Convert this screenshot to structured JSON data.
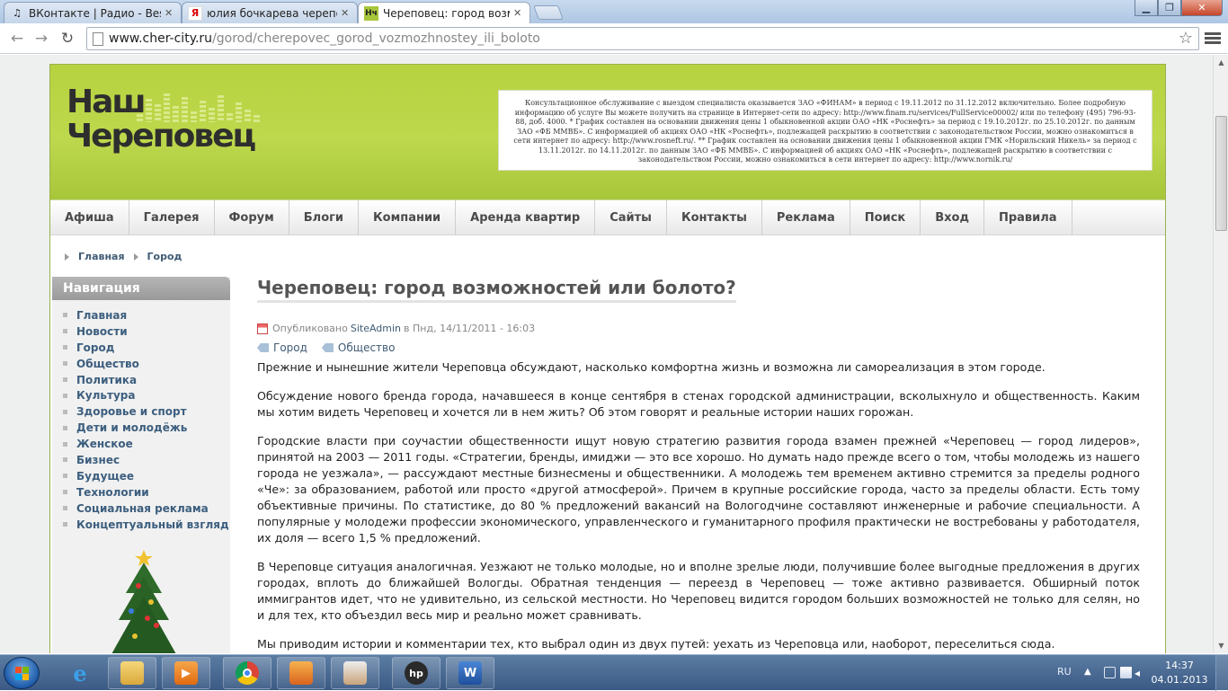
{
  "browser": {
    "tabs": [
      {
        "title": "ВКонтакте | Радио - Best F",
        "favicon": "music-note-icon",
        "active": false
      },
      {
        "title": "юлия бочкарева черепов",
        "favicon": "yandex-icon",
        "active": false
      },
      {
        "title": "Череповец: город возмож",
        "favicon": "nch-site-icon",
        "active": true
      }
    ],
    "url_domain": "www.cher-city.ru",
    "url_path": "/gorod/cherepovec_gorod_vozmozhnostey_ili_boloto"
  },
  "site": {
    "logo_line1": "Наш",
    "logo_line2": "Череповец",
    "ad_text": "Консультационное обслуживание с выездом специалиста оказывается ЗАО «ФИНАМ» в период с 19.11.2012 по 31.12.2012 включительно. Более подробную информацию об услуге Вы можете получить на странице в Интернет-сети по адресу: http://www.finam.ru/services/FullService00002/ или по телефону (495) 796-93-88, доб. 4000. * График составлен на основании движения цены 1 обыкновенной акции ОАО «НК «Роснефть» за период с 19.10.2012г. по 25.10.2012г. по данным ЗАО «ФБ ММВБ». С информацией об акциях ОАО «НК «Роснефть», подлежащей раскрытию в соответствии с законодательством России, можно ознакомиться в сети интернет по адресу: http://www.rosneft.ru/.  ** График составлен на основании движения цены 1 обыкновенной акции ГМК «Норильский Никель» за период с 13.11.2012г. по 14.11.2012г. по данным ЗАО «ФБ ММВБ». С информацией об акциях ОАО «НК «Роснефть», подлежащей раскрытию в соответствии с законодательством России, можно ознакомиться в сети интернет по адресу: http://www.nornik.ru/",
    "menu": [
      "Афиша",
      "Галерея",
      "Форум",
      "Блоги",
      "Компании",
      "Аренда квартир",
      "Сайты",
      "Контакты",
      "Реклама",
      "Поиск",
      "Вход",
      "Правила"
    ],
    "breadcrumbs": [
      "Главная",
      "Город"
    ],
    "nav_title": "Навигация",
    "nav_items": [
      "Главная",
      "Новости",
      "Город",
      "Общество",
      "Политика",
      "Культура",
      "Здоровье и спорт",
      "Дети и молодёжь",
      "Женское",
      "Бизнес",
      "Будущее",
      "Технологии",
      "Социальная реклама",
      "Концептуальный взгляд"
    ]
  },
  "article": {
    "title": "Череповец: город возможностей или болото?",
    "meta_prefix": "Опубликовано",
    "author": "SiteAdmin",
    "meta_date": "в Пнд, 14/11/2011 - 16:03",
    "tags": [
      "Город",
      "Общество"
    ],
    "paragraphs": [
      "Прежние и нынешние жители Череповца обсуждают, насколько комфортна жизнь и возможна ли самореализация в этом городе.",
      "Обсуждение нового бренда города, начавшееся в конце сентября в стенах городской администрации, всколыхнуло и общественность. Каким мы хотим видеть Череповец и хочется ли в нем жить? Об этом говорят и реальные истории наших горожан.",
      "Городские власти при соучастии общественности ищут новую стратегию развития города взамен прежней «Череповец — город лидеров», принятой на 2003 — 2011 годы. «Стратегии, бренды, имиджи — это все хорошо. Но думать надо прежде всего о том, чтобы молодежь из нашего города не уезжала», — рассуждают местные бизнесмены и общественники. А молодежь тем временем активно стремится за пределы родного «Че»: за образованием, работой или просто «другой атмосферой». Причем в крупные российские города, часто за пределы области. Есть тому объективные причины. По статистике, до 80 % предложений вакансий на Вологодчине составляют инженерные и рабочие специальности. А популярные у молодежи профессии экономического, управленческого и гуманитарного профиля практически не востребованы у работодателя, их доля — всего 1,5 % предложений.",
      "В Череповце ситуация аналогичная. Уезжают не только молодые, но и вполне зрелые люди, получившие более выгодные предложения в других городах, вплоть до ближайшей Вологды. Обратная тенденция — переезд в Череповец — тоже активно развивается. Обширный поток иммигрантов идет, что не удивительно, из сельской местности. Но Череповец видится городом больших возможностей не только для селян, но и для тех, кто объездил весь мир и реально может сравнивать.",
      "Мы приводим истории и комментарии тех, кто выбрал один из двух путей: уехать из Череповца или, наоборот, переселиться сюда."
    ]
  },
  "taskbar": {
    "lang": "RU",
    "time": "14:37",
    "date": "04.01.2013",
    "apps": [
      "internet-explorer-icon",
      "file-explorer-icon",
      "media-player-icon",
      "chrome-icon",
      "app-orange-icon",
      "app-tray-icon",
      "hp-icon",
      "word-icon"
    ]
  }
}
